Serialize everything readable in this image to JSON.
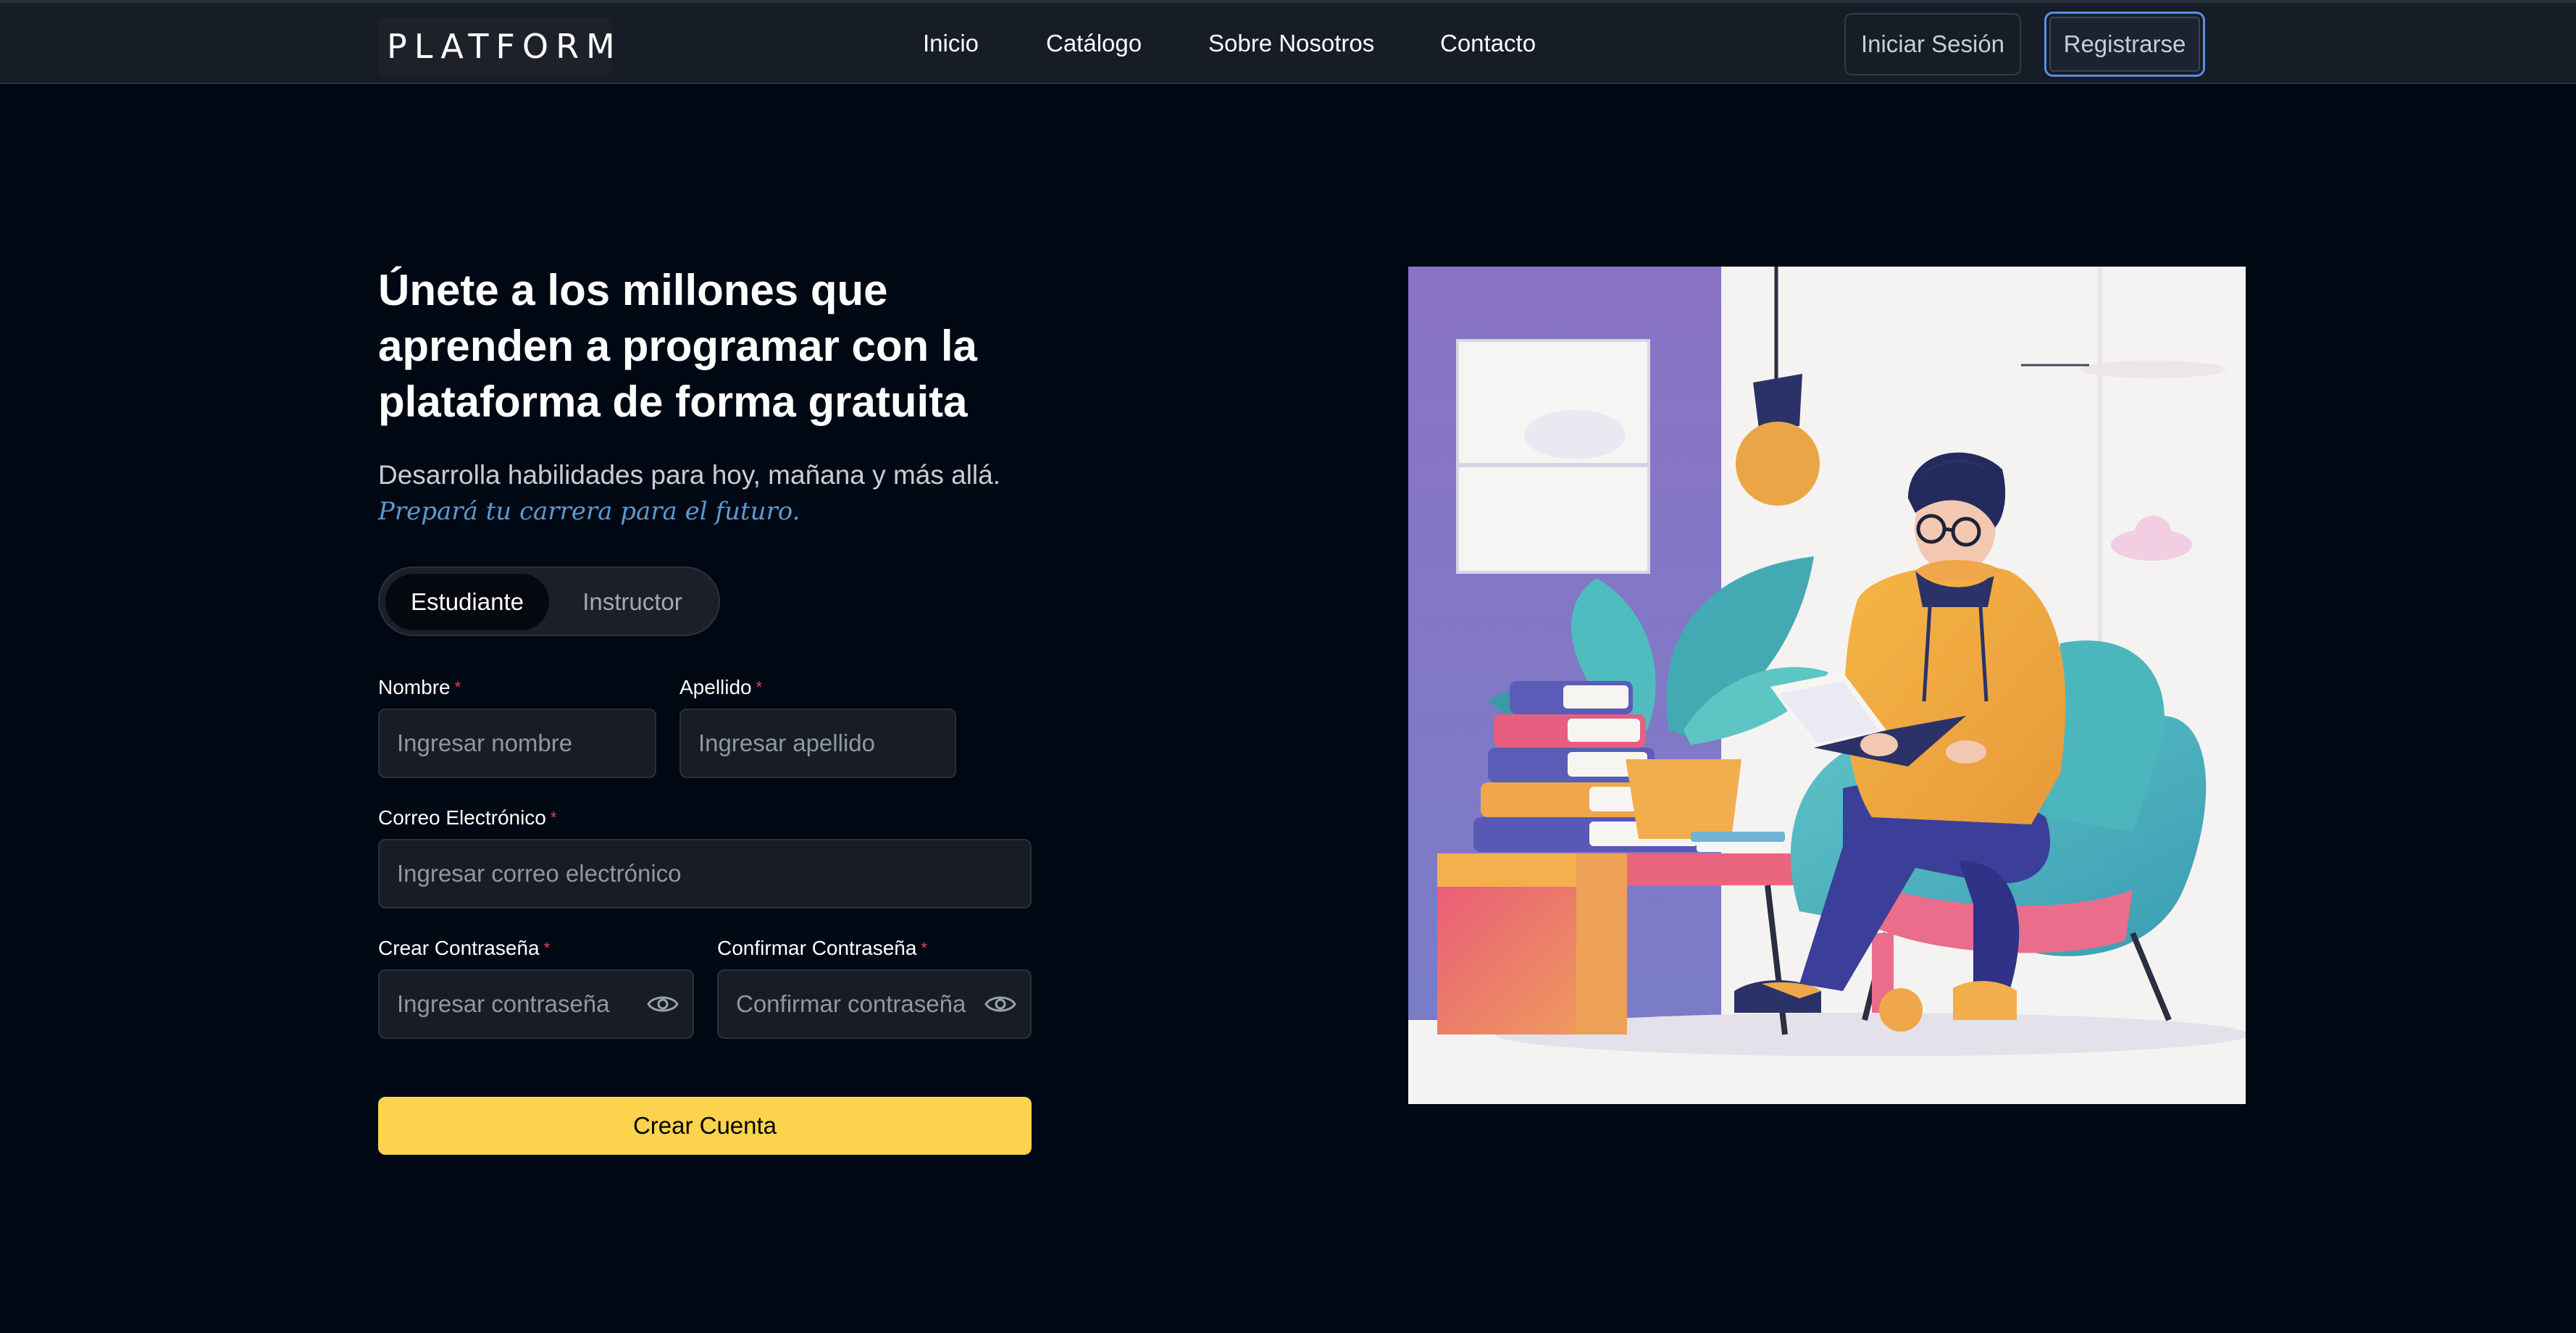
{
  "brand": {
    "logo_text": "PLATFORM"
  },
  "nav": {
    "links": [
      {
        "label": "Inicio"
      },
      {
        "label": "Catálogo"
      },
      {
        "label": "Sobre Nosotros"
      },
      {
        "label": "Contacto"
      }
    ],
    "login_label": "Iniciar Sesión",
    "register_label": "Registrarse"
  },
  "hero": {
    "title": "Únete a los millones que aprenden a programar con la plataforma de forma gratuita",
    "subtitle": "Desarrolla habilidades para hoy, mañana y más allá.",
    "tagline": "Prepará tu carrera para el futuro."
  },
  "role_toggle": {
    "options": [
      {
        "label": "Estudiante",
        "selected": true
      },
      {
        "label": "Instructor",
        "selected": false
      }
    ]
  },
  "form": {
    "required_mark": "*",
    "first_name": {
      "label": "Nombre",
      "placeholder": "Ingresar nombre"
    },
    "last_name": {
      "label": "Apellido",
      "placeholder": "Ingresar apellido"
    },
    "email": {
      "label": "Correo Electrónico",
      "placeholder": "Ingresar correo electrónico"
    },
    "password": {
      "label": "Crear Contraseña",
      "placeholder": "Ingresar contraseña",
      "toggle_icon": "eye-icon"
    },
    "confirm_password": {
      "label": "Confirmar Contraseña",
      "placeholder": "Confirmar contraseña",
      "toggle_icon": "eye-icon"
    },
    "submit_label": "Crear Cuenta"
  },
  "colors": {
    "background": "#000814",
    "navbar": "#161d27",
    "accent_yellow": "#fcd34d",
    "focus_blue": "#5a8ee6",
    "required_red": "#e0455a",
    "tagline_blue": "#5b9bd0"
  },
  "illustration": {
    "subject": "person-reading-book-illustration"
  }
}
